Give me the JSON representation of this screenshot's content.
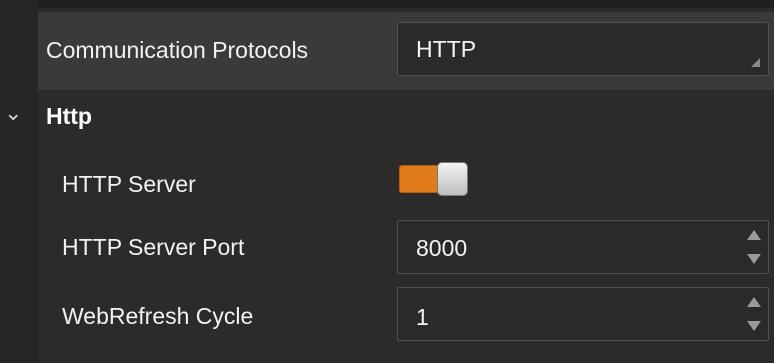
{
  "communication": {
    "label": "Communication Protocols",
    "value": "HTTP"
  },
  "http_section": {
    "title": "Http",
    "chevron": "chevron-down-icon",
    "server": {
      "label": "HTTP Server",
      "enabled": true
    },
    "port": {
      "label": "HTTP Server Port",
      "value": "8000"
    },
    "refresh": {
      "label": "WebRefresh Cycle",
      "value": "1"
    }
  },
  "colors": {
    "accent": "#e07c1c",
    "background": "#2b2b2b",
    "row_highlight": "#3a3a3a"
  }
}
